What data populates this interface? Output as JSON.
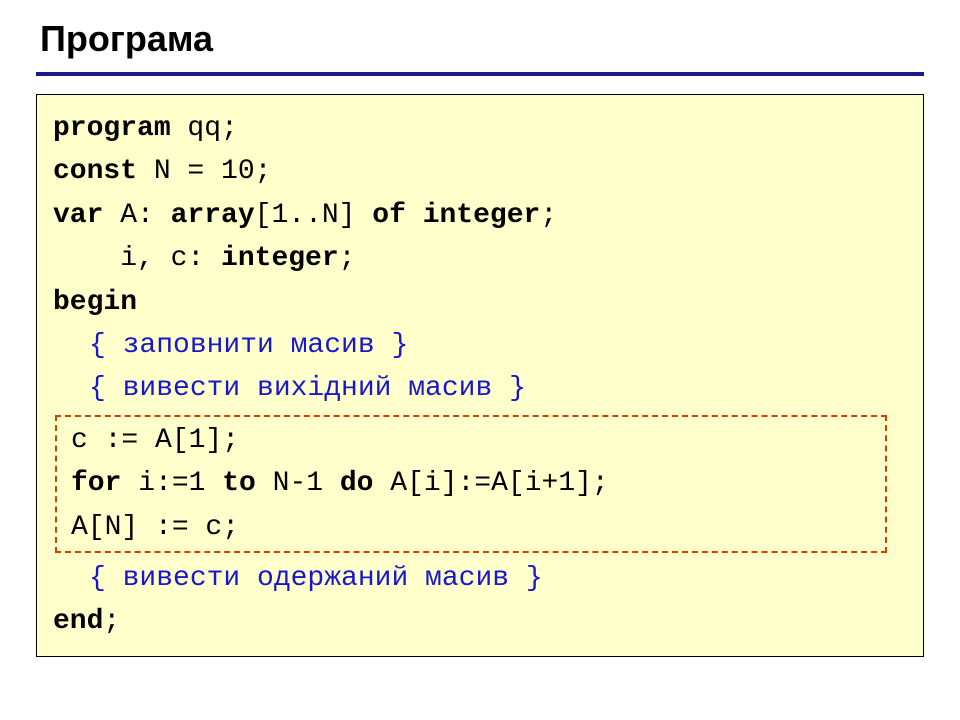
{
  "title": "Програма",
  "code": {
    "l1_kw": "program",
    "l1_rest": " qq;",
    "l2_kw": "const",
    "l2_rest": " N = 10;",
    "l3_kw1": "var",
    "l3_mid": " A: ",
    "l3_kw2": "array",
    "l3_mid2": "[1..N] ",
    "l3_kw3": "of",
    "l3_mid3": " ",
    "l3_kw4": "integer",
    "l3_end": ";",
    "l4_lead": "    i, c: ",
    "l4_kw": "integer",
    "l4_end": ";",
    "l5_kw": "begin",
    "c1": "{ заповнити масив }",
    "c2": "{ вивести вихідний масив }",
    "d1": "c := A[1];",
    "d2_kw1": "for",
    "d2_mid1": " i:=1 ",
    "d2_kw2": "to",
    "d2_mid2": " N-1 ",
    "d2_kw3": "do",
    "d2_mid3": " A[i]:=A[i+1];",
    "d3": "A[N] := c;",
    "c3": "{ вивести одержаний масив }",
    "l_end_kw": "end",
    "l_end_rest": ";"
  }
}
